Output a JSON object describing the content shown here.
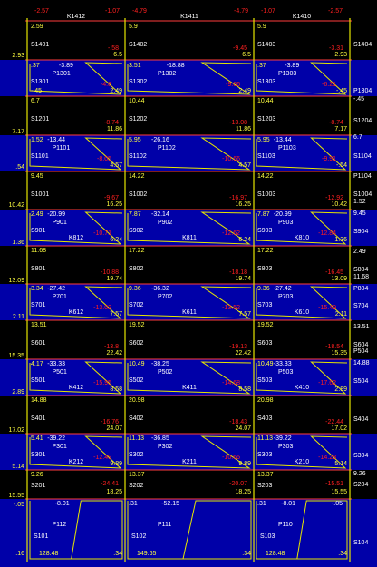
{
  "top_row": {
    "left_cols": [
      [
        "-2.57",
        "-1.07"
      ],
      [
        "-4.79",
        "-4.79"
      ],
      [
        "-1.07",
        "-2.57"
      ]
    ],
    "beams": [
      "K1412",
      "K1411",
      "K1410"
    ]
  },
  "levels": [
    {
      "left": "2.93",
      "right": "S1404"
    },
    {
      "left": "7.17",
      "right": "S1204"
    },
    {
      "left": ".54",
      "right": "S1104"
    },
    {
      "left": "10.42",
      "right": "S1004"
    },
    {
      "left": "1.36",
      "right": "S904"
    },
    {
      "left": "13.09",
      "right": "S804"
    },
    {
      "left": "2.11",
      "right": "S704"
    },
    {
      "left": "15.35",
      "right": "S604"
    },
    {
      "left": "2.89",
      "right": "S504"
    },
    {
      "left": "17.02",
      "right": "S404"
    },
    {
      "left": "5.14",
      "right": "S304"
    },
    {
      "left": "15.55",
      "right": "S204"
    },
    {
      "left": "-.05",
      "right": ""
    },
    {
      "left": ".16",
      "right": "S104"
    }
  ],
  "right_extra": [
    "P1304",
    "-.45",
    "6.7",
    "P1104",
    "1.52",
    "9.45",
    "2.49",
    "11.68",
    "P804",
    "13.51",
    "P504",
    "14.88",
    "9.26"
  ],
  "spans": [
    [
      {
        "top": "2.59",
        "a": "S1401",
        "b": "-.58",
        "c": "6.5",
        "slab": ".37",
        "d": "-3.89",
        "p": "P1301",
        "e": "S1301",
        "f": "-4.8",
        "g": "-.45",
        "h": "2.49"
      },
      {
        "top": "5.9",
        "a": "S1402",
        "b": "-9.45",
        "c": "6.5",
        "slab": "3.51",
        "d": "-18.88",
        "p": "P1302",
        "e": "S1302",
        "f": "-9.06",
        "g": "",
        "h": "2.49"
      },
      {
        "top": "5.9",
        "a": "S1403",
        "b": "-3.31",
        "c": "2.93",
        "slab": ".37",
        "d": "-3.89",
        "p": "P1303",
        "e": "S1303",
        "f": "-6.21",
        "g": "",
        "h": "-.45"
      }
    ]
  ],
  "cells": {
    "r1": [
      [
        "6.7",
        "S1201",
        "-8.74",
        "11.86"
      ],
      [
        "10.44",
        "S1202",
        "-13.08",
        "11.86"
      ],
      [
        "10.44",
        "S1203",
        "-8.74",
        "7.17"
      ]
    ],
    "r2": [
      [
        "1.52",
        "-13.44",
        "P1101",
        "S1101",
        "-8.05",
        "4.57"
      ],
      [
        "5.95",
        "-26.16",
        "P1102",
        "S1102",
        "-10.66",
        "4.57"
      ],
      [
        "5.95",
        "-13.44",
        "P1103",
        "S1103",
        "-9.91",
        "-.54"
      ]
    ],
    "r3": [
      [
        "9.45",
        "S1001",
        "-9.67",
        "16.25"
      ],
      [
        "14.22",
        "S1002",
        "-16.97",
        "16.25"
      ],
      [
        "14.22",
        "S1003",
        "-12.92",
        "10.42"
      ]
    ],
    "r4": [
      [
        "2.49",
        "-20.99",
        "P901",
        "S901",
        "-10.71",
        "6.24"
      ],
      [
        "7.87",
        "-32.14",
        "P902",
        "S902",
        "-12.62",
        "6.24"
      ],
      [
        "7.87",
        "-20.99",
        "P903",
        "S903",
        "-12.84",
        "1.36"
      ]
    ],
    "r5": [
      [
        "11.68",
        "S801",
        "-10.88",
        "19.74"
      ],
      [
        "17.22",
        "S802",
        "-18.18",
        "19.74"
      ],
      [
        "17.22",
        "S803",
        "-16.45",
        "13.09"
      ]
    ],
    "r6": [
      [
        "3.34",
        "-27.42",
        "P701",
        "S701",
        "-13.02",
        "7.57"
      ],
      [
        "9.36",
        "-36.32",
        "P702",
        "S702",
        "-13.52",
        "7.57"
      ],
      [
        "9.36",
        "-27.42",
        "P703",
        "S703",
        "-15.49",
        "2.11"
      ]
    ],
    "r7": [
      [
        "13.51",
        "S601",
        "-13.8",
        "22.42"
      ],
      [
        "19.52",
        "S602",
        "-19.13",
        "22.42"
      ],
      [
        "19.52",
        "S603",
        "-18.54",
        "15.35"
      ]
    ],
    "r8": [
      [
        "4.17",
        "-33.33",
        "P501",
        "S501",
        "-15.95",
        "8.58"
      ],
      [
        "10.49",
        "-38.25",
        "P502",
        "S502",
        "-14.68",
        "8.58"
      ],
      [
        "10.49",
        "-33.33",
        "P503",
        "S503",
        "-17.62",
        "2.89"
      ]
    ],
    "r9": [
      [
        "14.88",
        "S401",
        "-16.76",
        "24.07"
      ],
      [
        "20.98",
        "S402",
        "-18.43",
        "24.07"
      ],
      [
        "20.98",
        "S403",
        "-22.44",
        "17.02"
      ]
    ],
    "r10": [
      [
        "5.41",
        "-39.22",
        "P301",
        "S301",
        "-12.49",
        "9.89"
      ],
      [
        "11.13",
        "-36.85",
        "P302",
        "S302",
        "-10.65",
        "9.89"
      ],
      [
        "11.13",
        "-39.22",
        "P303",
        "S303",
        "-14.28",
        "5.14"
      ]
    ],
    "r11": [
      [
        "9.26",
        "S201",
        "-24.41",
        "18.25"
      ],
      [
        "13.37",
        "S202",
        "-20.07",
        "18.25"
      ],
      [
        "13.37",
        "S203",
        "-15.51",
        "15.55"
      ]
    ],
    "r12": [
      [
        "-8.01",
        "P112",
        "S101",
        "128.48",
        ".34"
      ],
      [
        "-52.15",
        "P111",
        "S102",
        "149.65",
        ".34"
      ],
      [
        "-8.01",
        "P110",
        "S103",
        "128.48",
        ".34"
      ]
    ]
  },
  "beam_labels": {
    "r4": [
      "K812",
      "K811",
      "K810"
    ],
    "r6": [
      "K612",
      "K611",
      "K610"
    ],
    "r8": [
      "K412",
      "K411",
      "K410"
    ],
    "r10": [
      "K212",
      "K211",
      "K210"
    ]
  },
  "colors": {
    "background": "#000000",
    "columns": "#e6e600",
    "beams": "#ff3b3b",
    "fill": "#0000a8",
    "negative": "#ff2020",
    "positive": "#ffff40"
  }
}
